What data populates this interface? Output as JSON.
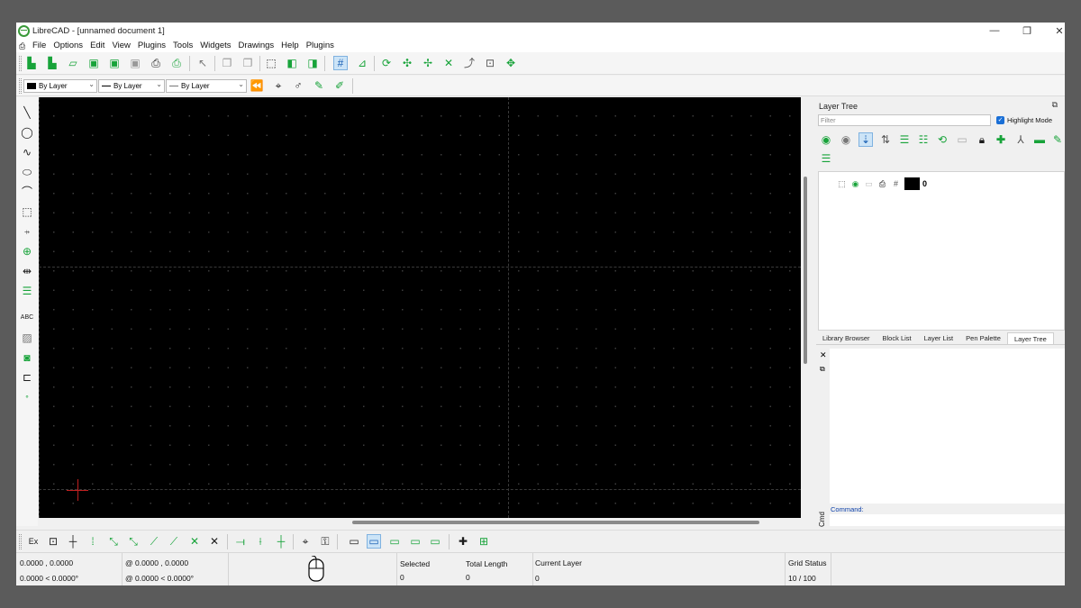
{
  "window": {
    "title": "LibreCAD - [unnamed document 1]",
    "controls": [
      "—",
      "❐",
      "✕"
    ]
  },
  "menu": [
    "File",
    "Options",
    "Edit",
    "View",
    "Plugins",
    "Tools",
    "Widgets",
    "Drawings",
    "Help",
    "Plugins"
  ],
  "pen_toolbar": {
    "color": "By Layer",
    "linetype": "By Layer",
    "linewidth": "By Layer"
  },
  "layer_tree": {
    "title": "Layer Tree",
    "filter_placeholder": "Filter",
    "highlight_mode_label": "Highlight Mode",
    "highlight_mode_checked": true,
    "layers": [
      {
        "name": "0",
        "visible": true,
        "color": "#000000"
      }
    ]
  },
  "dock_tabs": [
    "Library Browser",
    "Block List",
    "Layer List",
    "Pen Palette",
    "Layer Tree"
  ],
  "active_dock_tab": "Layer Tree",
  "command": {
    "side_label": "Cmd",
    "prompt_label": "Command:"
  },
  "snap_toolbar": {
    "exclusive_label": "Ex"
  },
  "status": {
    "abs_coords": "0.0000 , 0.0000",
    "abs_polar": "0.0000 < 0.0000°",
    "rel_coords": "@  0.0000 , 0.0000",
    "rel_polar": "@  0.0000 < 0.0000°",
    "selected_label": "Selected",
    "selected_value": "0",
    "total_length_label": "Total Length",
    "total_length_value": "0",
    "current_layer_label": "Current Layer",
    "current_layer_value": "0",
    "grid_status_label": "Grid Status",
    "grid_status_value": "10 / 100"
  },
  "colors": {
    "canvas": "#000000",
    "accent_green": "#18a33a",
    "crosshair": "#c02020",
    "command_label": "#0b3fa8"
  },
  "icons": {
    "main_toolbar": [
      "new-document-icon",
      "new-from-template-icon",
      "open-icon",
      "save-icon",
      "save-as-icon",
      "save-all-icon",
      "print-icon",
      "print-preview-icon",
      "select-pointer-icon",
      "copy-icon",
      "paste-icon",
      "cut-icon",
      "undo-icon",
      "redo-icon",
      "grid-icon",
      "draft-icon",
      "zoom-redraw-icon",
      "zoom-in-icon",
      "zoom-out-icon",
      "zoom-auto-icon",
      "zoom-previous-icon",
      "zoom-window-icon",
      "zoom-pan-icon"
    ],
    "left_toolbar": [
      "line-icon",
      "circle-icon",
      "freehand-icon",
      "ellipse-icon",
      "polyline-icon",
      "select-icon",
      "dimension-icon",
      "modify-icon",
      "info-icon",
      "block-icon",
      "text-icon",
      "hatch-icon",
      "image-icon",
      "insert-block-icon",
      "point-icon"
    ]
  }
}
